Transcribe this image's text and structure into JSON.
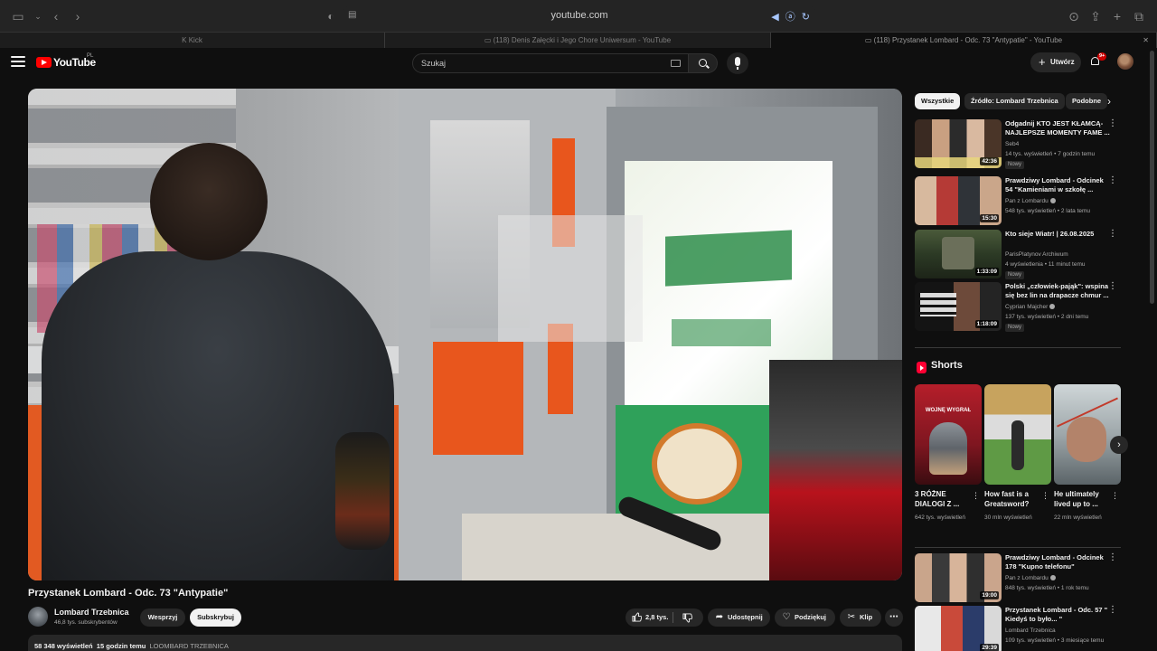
{
  "browser": {
    "url": "youtube.com",
    "tabs": [
      {
        "label": "Kick",
        "active": false
      },
      {
        "label": "(118) Denis Załęcki i Jego Chore Uniwersum - YouTube",
        "active": false
      },
      {
        "label": "(118) Przystanek Lombard - Odc. 73 \"Antypatie\" - YouTube",
        "active": true
      }
    ]
  },
  "masthead": {
    "logo_text": "YouTube",
    "region": "PL",
    "search_placeholder": "Szukaj",
    "create_label": "Utwórz",
    "notifications_badge": "9+"
  },
  "video": {
    "title": "Przystanek Lombard - Odc. 73 \"Antypatie\"",
    "channel": "Lombard Trzebnica",
    "subscribers": "46,8 tys. subskrybentów",
    "support_label": "Wesprzyj",
    "subscribe_label": "Subskrybuj",
    "likes": "2,8 tys.",
    "share_label": "Udostępnij",
    "thanks_label": "Podziękuj",
    "clip_label": "Klip",
    "views": "58 348 wyświetleń",
    "age": "15 godzin temu",
    "hashtag": "LOOMBARD TRZEBNICA"
  },
  "chips": [
    "Wszystkie",
    "Źródło: Lombard Trzebnica",
    "Podobne"
  ],
  "recommendations": [
    {
      "title": "Odgadnij KTO JEST KŁAMCĄ- NAJLEPSZE MOMENTY FAME ...",
      "channel": "Seb4",
      "stats": "14 tys. wyświetleń • 7 godzin temu",
      "duration": "42:36",
      "badge": "Nowy",
      "verified": false
    },
    {
      "title": "Prawdziwy Lombard - Odcinek 54 \"Kamieniami w szkołę ...",
      "channel": "Pan z Lombardu",
      "stats": "548 tys. wyświetleń • 2 lata temu",
      "duration": "15:30",
      "badge": "",
      "verified": true
    },
    {
      "title": "Kto sieje Wiatr! | 26.08.2025",
      "channel": "ParisPlatynov Archiwum",
      "stats": "4 wyświetlenia • 11 minut temu",
      "duration": "1:33:09",
      "badge": "Nowy",
      "verified": false
    },
    {
      "title": "Polski „człowiek-pająk\": wspina się bez lin na drapacze chmur ...",
      "channel": "Cyprian Majcher",
      "stats": "137 tys. wyświetleń • 2 dni temu",
      "duration": "1:18:09",
      "badge": "Nowy",
      "verified": true
    }
  ],
  "shorts": {
    "heading": "Shorts",
    "items": [
      {
        "title": "3 RÓŻNE DIALOGI Z ...",
        "views": "642 tys. wyświetleń",
        "overlay": "WOJNĘ WYGRAŁ"
      },
      {
        "title": "How fast is a Greatsword?",
        "views": "30 mln wyświetleń",
        "overlay": ""
      },
      {
        "title": "He ultimately lived up to ...",
        "views": "22 mln wyświetleń",
        "overlay": ""
      }
    ]
  },
  "recommendations_lower": [
    {
      "title": "Prawdziwy Lombard - Odcinek 178 \"Kupno telefonu\"",
      "channel": "Pan z Lombardu",
      "stats": "848 tys. wyświetleń • 1 rok temu",
      "duration": "19:00",
      "verified": true
    },
    {
      "title": "Przystanek Lombard - Odc. 57 \" Kiedyś to było... \"",
      "channel": "Lombard Trzebnica",
      "stats": "109 tys. wyświetleń • 3 miesiące temu",
      "duration": "29:39",
      "verified": false
    }
  ],
  "colors": {
    "background": "#0f0f0f",
    "surface": "#272727",
    "accent_red": "#ff0000",
    "text_primary": "#f1f1f1",
    "text_secondary": "#aaaaaa"
  }
}
